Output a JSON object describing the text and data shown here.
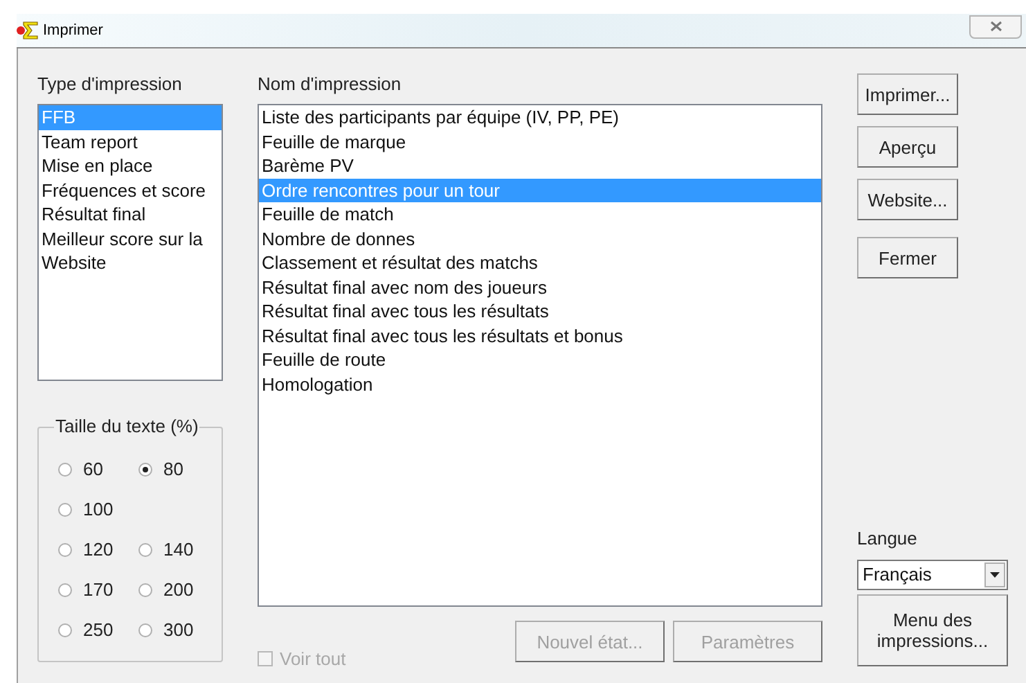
{
  "window": {
    "title": "Imprimer"
  },
  "type_list": {
    "label": "Type d'impression",
    "items": [
      {
        "text": "FFB",
        "selected": true
      },
      {
        "text": "Team report",
        "selected": false
      },
      {
        "text": "Mise en place",
        "selected": false
      },
      {
        "text": "Fréquences et score",
        "selected": false
      },
      {
        "text": "Résultat final",
        "selected": false
      },
      {
        "text": "Meilleur score sur la",
        "selected": false
      },
      {
        "text": "Website",
        "selected": false
      }
    ]
  },
  "text_size": {
    "label": "Taille du texte (%)",
    "rows": [
      [
        {
          "text": "60",
          "selected": false
        },
        {
          "text": "80",
          "selected": true
        }
      ],
      [
        {
          "text": "100",
          "selected": false
        }
      ],
      [
        {
          "text": "120",
          "selected": false
        },
        {
          "text": "140",
          "selected": false
        }
      ],
      [
        {
          "text": "170",
          "selected": false
        },
        {
          "text": "200",
          "selected": false
        }
      ],
      [
        {
          "text": "250",
          "selected": false
        },
        {
          "text": "300",
          "selected": false
        }
      ]
    ]
  },
  "name_list": {
    "label": "Nom d'impression",
    "items": [
      {
        "text": "Liste des participants par équipe (IV, PP, PE)",
        "selected": false
      },
      {
        "text": "Feuille de marque",
        "selected": false
      },
      {
        "text": "Barème PV",
        "selected": false
      },
      {
        "text": "Ordre rencontres pour un tour",
        "selected": true
      },
      {
        "text": "Feuille de match",
        "selected": false
      },
      {
        "text": "Nombre de donnes",
        "selected": false
      },
      {
        "text": "Classement et résultat des matchs",
        "selected": false
      },
      {
        "text": "Résultat final avec nom des joueurs",
        "selected": false
      },
      {
        "text": "Résultat final avec tous les résultats",
        "selected": false
      },
      {
        "text": "Résultat final avec tous les résultats et bonus",
        "selected": false
      },
      {
        "text": "Feuille de route",
        "selected": false
      },
      {
        "text": "Homologation",
        "selected": false
      }
    ]
  },
  "show_all": {
    "label": "Voir tout",
    "checked": false,
    "disabled": true
  },
  "bottom_buttons": [
    {
      "label": "Nouvel état...",
      "disabled": true
    },
    {
      "label": "Paramètres",
      "disabled": true
    }
  ],
  "side_buttons": [
    {
      "label": "Imprimer..."
    },
    {
      "label": "Aperçu"
    },
    {
      "label": "Website..."
    },
    {
      "label": "Fermer"
    }
  ],
  "language": {
    "label": "Langue",
    "value": "Français"
  },
  "menu_button": {
    "label": "Menu des impressions..."
  }
}
